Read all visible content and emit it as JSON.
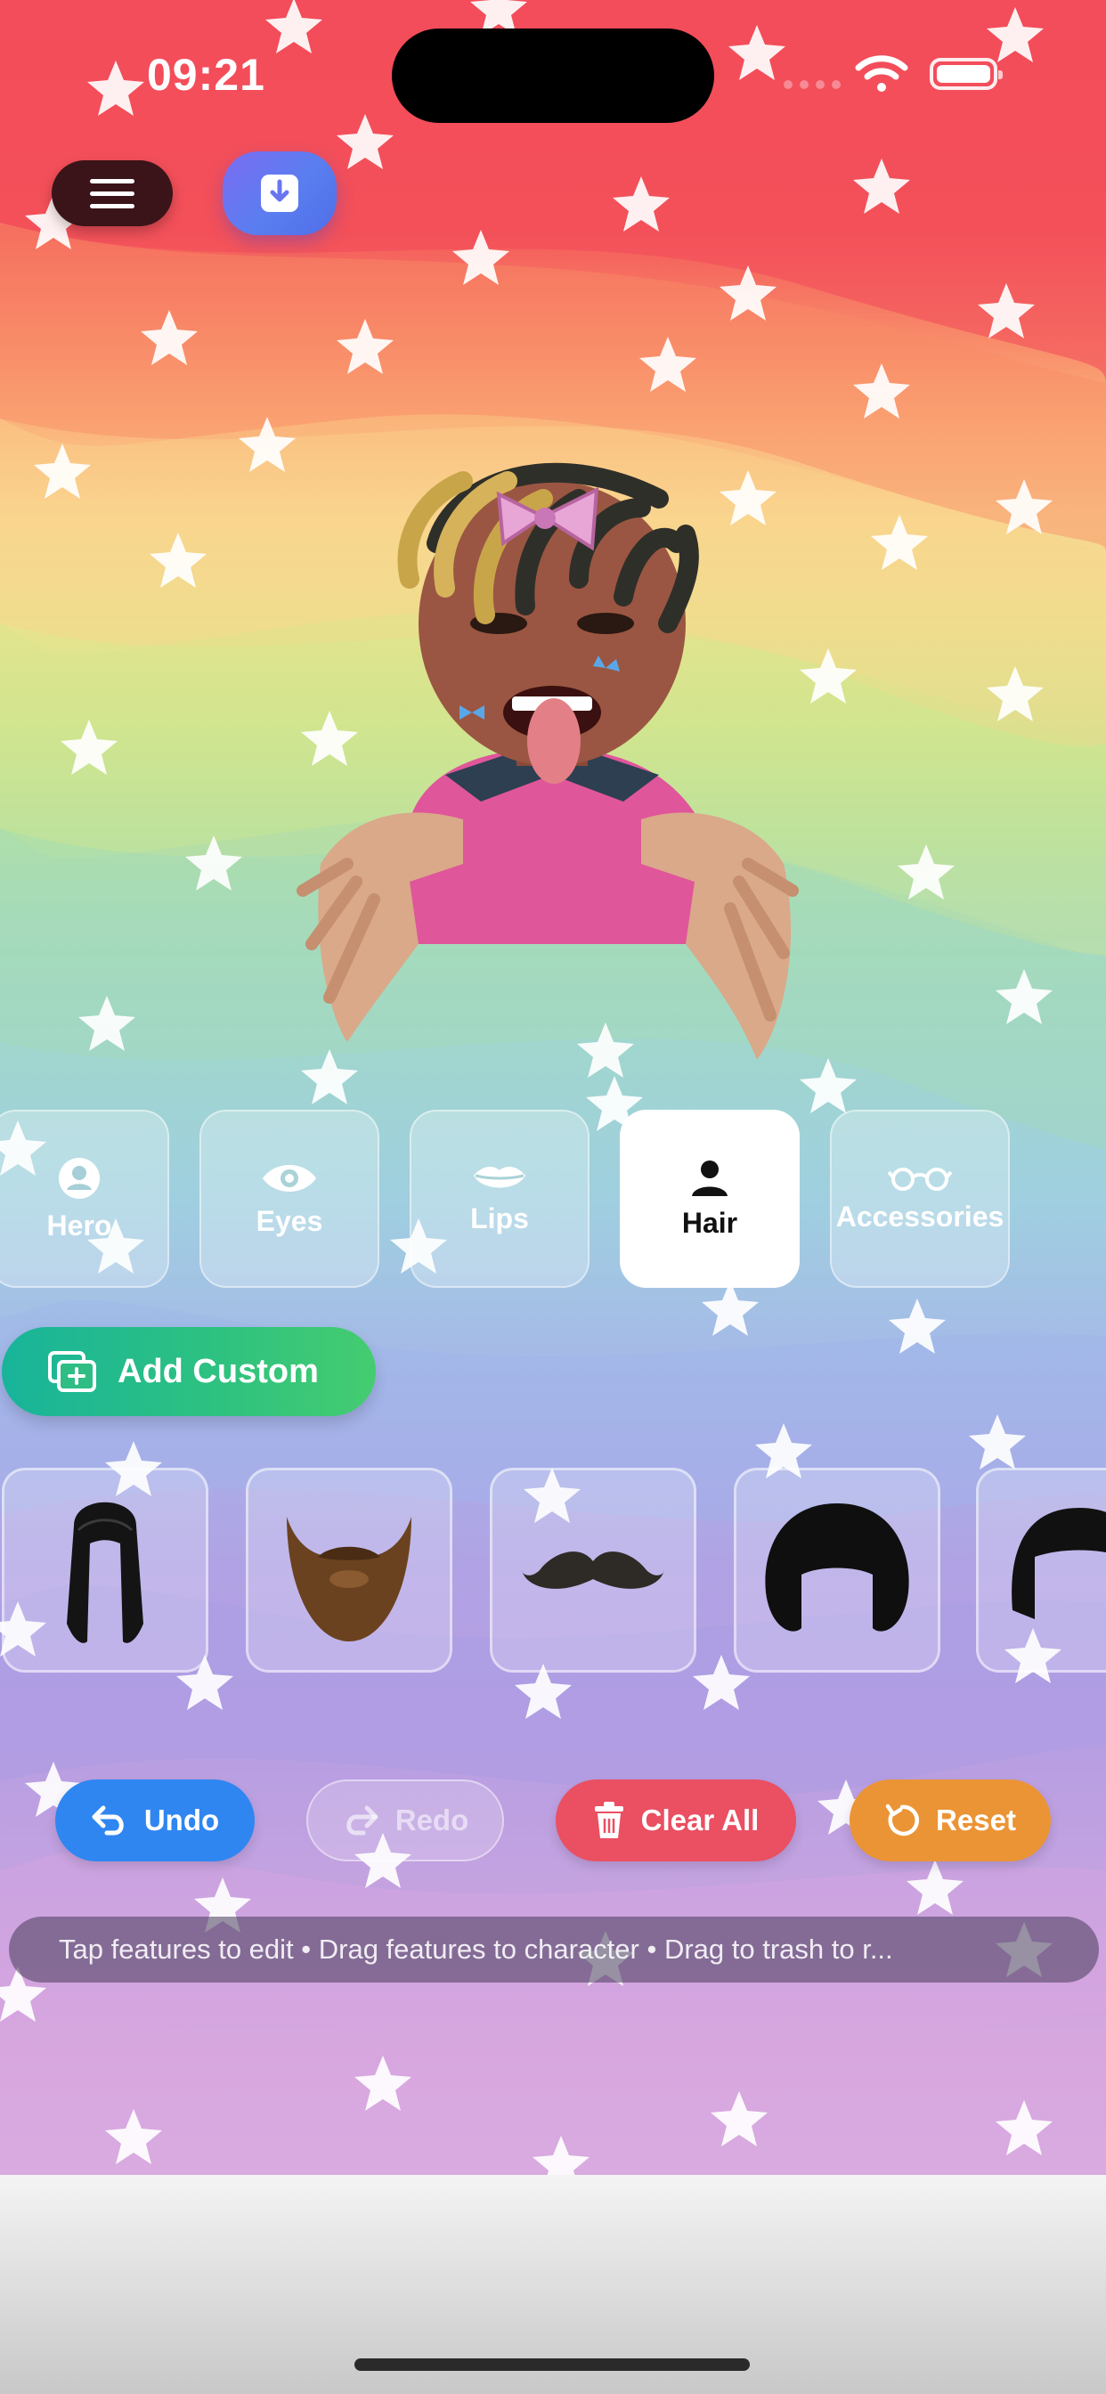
{
  "status_bar": {
    "time": "09:21"
  },
  "tabs": [
    {
      "label": "Hero",
      "icon": "user-circle-icon",
      "active": false
    },
    {
      "label": "Eyes",
      "icon": "eye-icon",
      "active": false
    },
    {
      "label": "Lips",
      "icon": "lips-icon",
      "active": false
    },
    {
      "label": "Hair",
      "icon": "person-icon",
      "active": true
    },
    {
      "label": "Accessories",
      "icon": "glasses-icon",
      "active": false
    }
  ],
  "add_custom": {
    "label": "Add Custom"
  },
  "items": [
    {
      "name": "long-black-hair"
    },
    {
      "name": "brown-beard"
    },
    {
      "name": "mustache"
    },
    {
      "name": "afro-hair"
    },
    {
      "name": "black-bob-hair"
    }
  ],
  "actions": {
    "undo": "Undo",
    "redo": "Redo",
    "clear_all": "Clear All",
    "reset": "Reset"
  },
  "hint": "Tap features to edit • Drag features to character • Drag to trash to r...",
  "colors": {
    "undo": "#2f86f0",
    "clear_all": "#ea4f62",
    "reset": "#eb9435",
    "add_custom": "#2fc27f",
    "download": "#6a76f0"
  }
}
